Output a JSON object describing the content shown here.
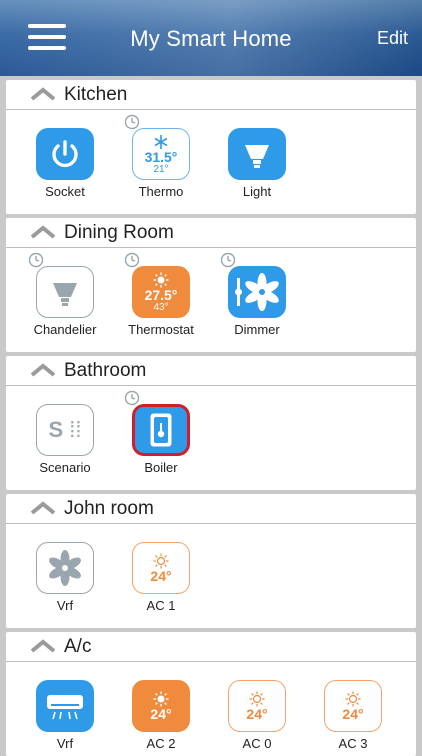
{
  "header": {
    "title": "My Smart Home",
    "edit_label": "Edit"
  },
  "colors": {
    "header": "#2f62a0",
    "device_blue": "#2e9ae8",
    "device_orange": "#f08a3c",
    "selected_border": "#d01e2a"
  },
  "rooms": [
    {
      "name": "Kitchen",
      "devices": [
        {
          "label": "Socket",
          "icon": "power-icon",
          "style": "blue"
        },
        {
          "label": "Thermo",
          "icon": "snowflake-icon",
          "style": "outline-blue",
          "temp": "31.5°",
          "subtemp": "21°",
          "timer": true
        },
        {
          "label": "Light",
          "icon": "lamp-icon",
          "style": "blue"
        }
      ]
    },
    {
      "name": "Dining Room",
      "devices": [
        {
          "label": "Chandelier",
          "icon": "lamp-icon",
          "style": "outline-grey",
          "timer": true
        },
        {
          "label": "Thermostat",
          "icon": "sun-icon",
          "style": "orange",
          "temp": "27.5°",
          "subtemp": "43°",
          "timer": true
        },
        {
          "label": "Dimmer",
          "icon": "fan-icon",
          "style": "blue",
          "timer": true
        }
      ]
    },
    {
      "name": "Bathroom",
      "devices": [
        {
          "label": "Scenario",
          "icon": "scenario-icon",
          "style": "outline-grey",
          "text": "S",
          "timer": false
        },
        {
          "label": "Boiler",
          "icon": "boiler-icon",
          "style": "red",
          "timer": true,
          "selected": true
        }
      ]
    },
    {
      "name": "John room",
      "devices": [
        {
          "label": "Vrf",
          "icon": "fan-icon",
          "style": "outline-grey"
        },
        {
          "label": "AC 1",
          "icon": "sun-icon",
          "style": "outline-orange",
          "temp": "24°"
        }
      ]
    },
    {
      "name": "A/c",
      "devices": [
        {
          "label": "Vrf",
          "icon": "ac-unit-icon",
          "style": "blue"
        },
        {
          "label": "AC 2",
          "icon": "sun-icon",
          "style": "orange",
          "temp": "24°"
        },
        {
          "label": "AC 0",
          "icon": "sun-icon",
          "style": "outline-orange",
          "temp": "24°"
        },
        {
          "label": "AC 3",
          "icon": "sun-icon",
          "style": "outline-orange",
          "temp": "24°"
        }
      ]
    }
  ]
}
